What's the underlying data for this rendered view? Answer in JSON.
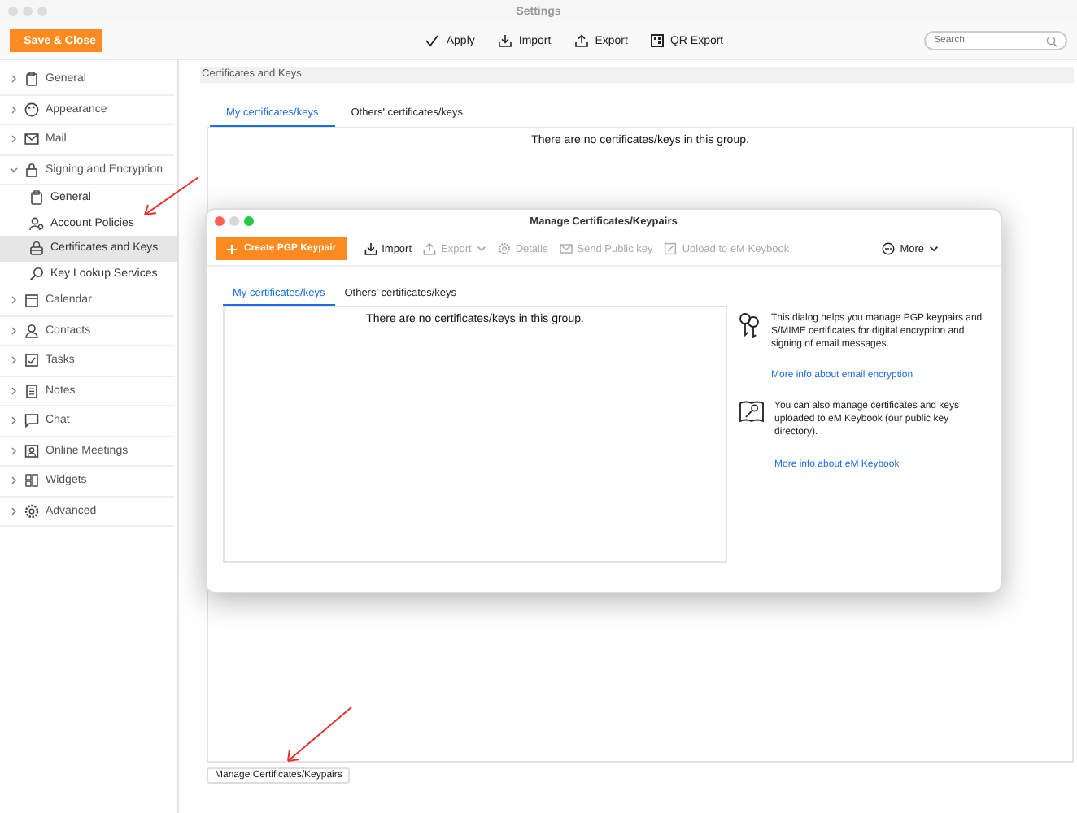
{
  "window": {
    "title": "Settings"
  },
  "toolbar": {
    "save_button": "Save & Close",
    "actions": [
      {
        "label": "Apply"
      },
      {
        "label": "Import"
      },
      {
        "label": "Export"
      },
      {
        "label": "QR Export"
      }
    ],
    "search": {
      "placeholder": "Search"
    }
  },
  "sidebar": {
    "items": [
      {
        "label": "General",
        "expanded": false,
        "selected": false
      },
      {
        "label": "Appearance",
        "expanded": false,
        "selected": false
      },
      {
        "label": "Mail",
        "expanded": false,
        "selected": false
      },
      {
        "label": "Signing and Encryption",
        "expanded": true,
        "selected": false,
        "children": [
          {
            "label": "General",
            "selected": false
          },
          {
            "label": "Account Policies",
            "selected": false
          },
          {
            "label": "Certificates and Keys",
            "selected": true
          },
          {
            "label": "Key Lookup Services",
            "selected": false
          }
        ]
      },
      {
        "label": "Calendar",
        "expanded": false,
        "selected": false
      },
      {
        "label": "Contacts",
        "expanded": false,
        "selected": false
      },
      {
        "label": "Tasks",
        "expanded": false,
        "selected": false
      },
      {
        "label": "Notes",
        "expanded": false,
        "selected": false
      },
      {
        "label": "Chat",
        "expanded": false,
        "selected": false
      },
      {
        "label": "Online Meetings",
        "expanded": false,
        "selected": false
      },
      {
        "label": "Widgets",
        "expanded": false,
        "selected": false
      },
      {
        "label": "Advanced",
        "expanded": false,
        "selected": false
      }
    ]
  },
  "content": {
    "section_title": "Certificates and Keys",
    "tabs": [
      {
        "label": "My certificates/keys",
        "selected": true
      },
      {
        "label": "Others' certificates/keys",
        "selected": false
      }
    ],
    "empty_message": "There are no certificates/keys in this group.",
    "manage_button": "Manage Certificates/Keypairs"
  },
  "dialog": {
    "title": "Manage Certificates/Keypairs",
    "toolbar": [
      {
        "kind": "primary",
        "label": "Create PGP Keypair",
        "disabled": false
      },
      {
        "kind": "import",
        "label": "Import",
        "disabled": false
      },
      {
        "kind": "export",
        "label": "Export",
        "disabled": true
      },
      {
        "kind": "details",
        "label": "Details",
        "disabled": true
      },
      {
        "kind": "send",
        "label": "Send Public key",
        "disabled": true
      },
      {
        "kind": "upload",
        "label": "Upload to eM Keybook",
        "disabled": true
      },
      {
        "kind": "more",
        "label": "More",
        "disabled": false
      }
    ],
    "tabs": [
      {
        "label": "My certificates/keys",
        "selected": true
      },
      {
        "label": "Others' certificates/keys",
        "selected": false
      }
    ],
    "empty_message": "There are no certificates/keys in this group.",
    "info": [
      {
        "kind": "keys",
        "text": "This dialog helps you manage PGP keypairs and S/MIME certificates for digital encryption and signing of email messages.",
        "link": "More info about email encryption"
      },
      {
        "kind": "keybook",
        "text": "You can also manage certificates and keys uploaded to eM Keybook (our public key directory).",
        "link": "More info about eM Keybook"
      }
    ]
  }
}
